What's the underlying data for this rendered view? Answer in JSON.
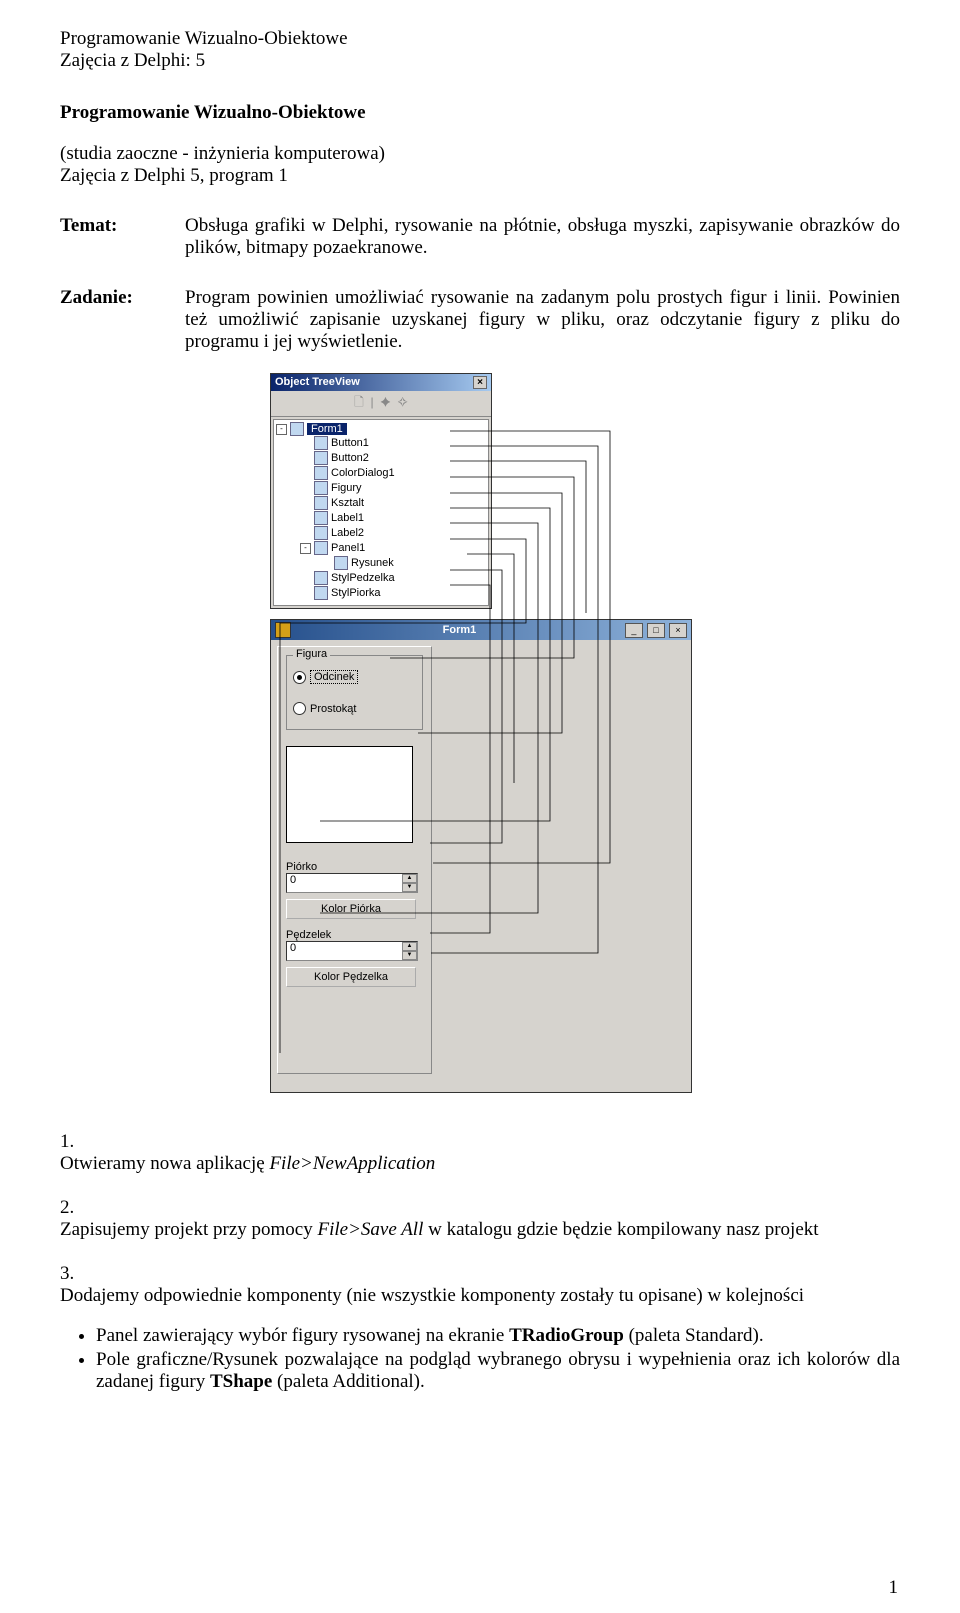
{
  "header": {
    "line1": "Programowanie Wizualno-Obiektowe",
    "line2": "Zajęcia z Delphi: 5"
  },
  "title": {
    "main": "Programowanie Wizualno-Obiektowe",
    "sub1": "(studia zaoczne - inżynieria komputerowa)",
    "sub2": "Zajęcia z Delphi 5, program 1"
  },
  "temat": {
    "label": "Temat:",
    "text": "Obsługa grafiki w Delphi, rysowanie na płótnie, obsługa myszki, zapisywanie obrazków do plików, bitmapy pozaekranowe."
  },
  "zadanie": {
    "label": "Zadanie:",
    "text": "Program powinien umożliwiać rysowanie na zadanym polu prostych figur i linii. Powinien też umożliwić zapisanie uzyskanej figury w pliku, oraz odczytanie figury z pliku do programu i jej wyświetlenie."
  },
  "treeview": {
    "title": "Object TreeView",
    "root": "Form1",
    "items": [
      "Button1",
      "Button2",
      "ColorDialog1",
      "Figury",
      "Ksztalt",
      "Label1",
      "Label2",
      "Panel1"
    ],
    "subitem": "Rysunek",
    "items2": [
      "StylPedzelka",
      "StylPiorka"
    ]
  },
  "form1": {
    "title": "Form1",
    "group": "Figura",
    "radio1": "Odcinek",
    "radio2": "Prostokąt",
    "label_piorko": "Piórko",
    "val_piorko": "0",
    "btn_piorko": "Kolor Piórka",
    "label_pedzelek": "Pędzelek",
    "val_pedzelek": "0",
    "btn_pedzelek": "Kolor Pędzelka"
  },
  "steps": {
    "n1": "1.",
    "t1a": "Otwieramy nowa aplikację ",
    "t1b": "File>NewApplication",
    "n2": "2.",
    "t2a": "Zapisujemy projekt przy pomocy ",
    "t2b": "File>Save All",
    "t2c": " w katalogu gdzie będzie kompilowany nasz projekt",
    "n3": "3.",
    "t3": "Dodajemy odpowiednie komponenty (nie wszystkie komponenty zostały tu opisane) w kolejności"
  },
  "bullets": {
    "b1a": "Panel zawierający wybór figury rysowanej na ekranie ",
    "b1b": "TRadioGroup",
    "b1c": " (paleta Standard).",
    "b2a": "Pole graficzne/Rysunek pozwalające na podgląd wybranego obrysu i wypełnienia oraz ich kolorów dla zadanej figury ",
    "b2b": "TShape",
    "b2c": " (paleta Additional)."
  },
  "page_number": "1"
}
